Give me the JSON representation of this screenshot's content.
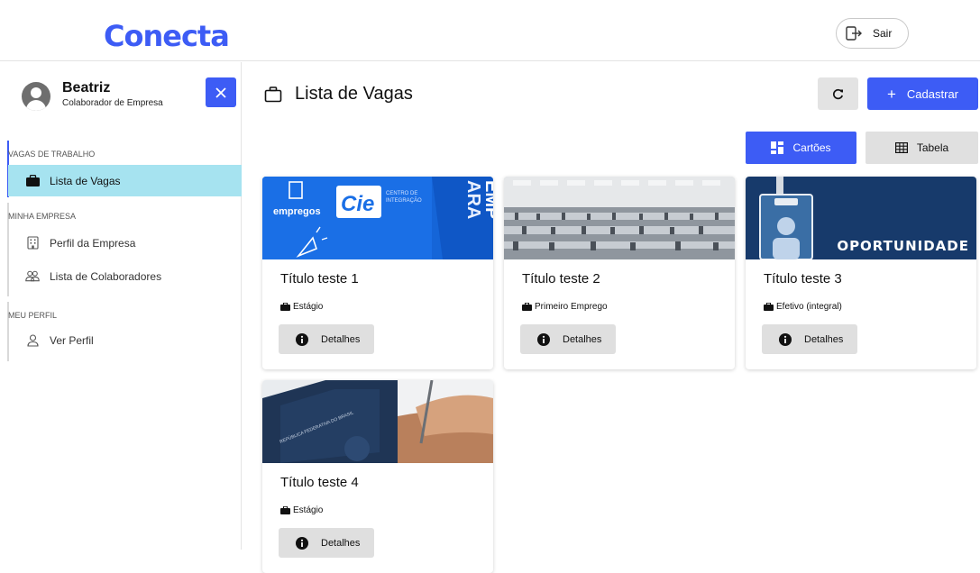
{
  "header": {
    "logo": "Conecta",
    "logout_label": "Sair"
  },
  "user": {
    "name": "Beatriz",
    "role": "Colaborador de Empresa"
  },
  "sidebar": {
    "sections": [
      {
        "label": "VAGAS DE TRABALHO",
        "items": [
          {
            "label": "Lista de Vagas",
            "icon": "briefcase-icon",
            "active": true
          }
        ]
      },
      {
        "label": "MINHA EMPRESA",
        "items": [
          {
            "label": "Perfil da Empresa",
            "icon": "building-icon"
          },
          {
            "label": "Lista de Colaboradores",
            "icon": "users-icon"
          }
        ]
      },
      {
        "label": "MEU PERFIL",
        "items": [
          {
            "label": "Ver Perfil",
            "icon": "user-icon"
          }
        ]
      }
    ]
  },
  "main": {
    "title": "Lista de Vagas",
    "new_label": "Cadastrar",
    "view_cards_label": "Cartões",
    "view_table_label": "Tabela",
    "active_view": "cards"
  },
  "jobs": [
    {
      "title": "Título teste 1",
      "type": "Estágio",
      "details_label": "Detalhes",
      "image": "empregos-ciee-banner"
    },
    {
      "title": "Título teste 2",
      "type": "Primeiro Emprego",
      "details_label": "Detalhes",
      "image": "office-workspace-photo"
    },
    {
      "title": "Título teste 3",
      "type": "Efetivo (integral)",
      "details_label": "Detalhes",
      "image": "oportunidade-badge-banner",
      "image_text": "OPORTUNIDADE"
    },
    {
      "title": "Título teste 4",
      "type": "Estágio",
      "details_label": "Detalhes",
      "image": "work-card-signing-photo"
    }
  ],
  "colors": {
    "primary": "#3d5cf5",
    "active_nav": "#a6e3f0",
    "secondary_button": "#e0e0e0"
  }
}
